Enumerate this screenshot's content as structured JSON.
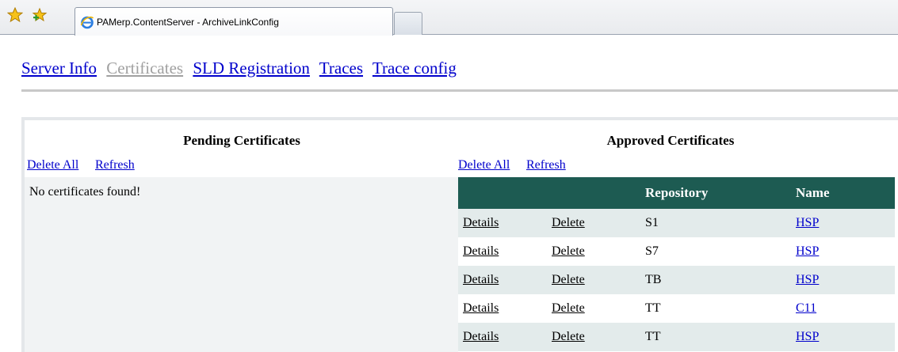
{
  "browser": {
    "tab_title": "PAMerp.ContentServer - ArchiveLinkConfig"
  },
  "nav": {
    "items": [
      {
        "label": "Server Info",
        "current": false
      },
      {
        "label": "Certificates",
        "current": true
      },
      {
        "label": "SLD Registration",
        "current": false
      },
      {
        "label": "Traces",
        "current": false
      },
      {
        "label": "Trace config",
        "current": false
      }
    ]
  },
  "pending": {
    "title": "Pending Certificates",
    "delete_all": "Delete All",
    "refresh": "Refresh",
    "empty_message": "No certificates found!"
  },
  "approved": {
    "title": "Approved Certificates",
    "delete_all": "Delete All",
    "refresh": "Refresh",
    "columns": [
      "",
      "",
      "Repository",
      "Name"
    ],
    "rows": [
      {
        "details": "Details",
        "delete": "Delete",
        "repository": "S1",
        "name": "HSP"
      },
      {
        "details": "Details",
        "delete": "Delete",
        "repository": "S7",
        "name": "HSP"
      },
      {
        "details": "Details",
        "delete": "Delete",
        "repository": "TB",
        "name": "HSP"
      },
      {
        "details": "Details",
        "delete": "Delete",
        "repository": "TT",
        "name": "C11"
      },
      {
        "details": "Details",
        "delete": "Delete",
        "repository": "TT",
        "name": "HSP"
      }
    ]
  },
  "colors": {
    "header_bg": "#1d5b52",
    "row_alt": "#e3ebeb",
    "link": "#0000cc",
    "nav_current": "#a0a0a0"
  }
}
